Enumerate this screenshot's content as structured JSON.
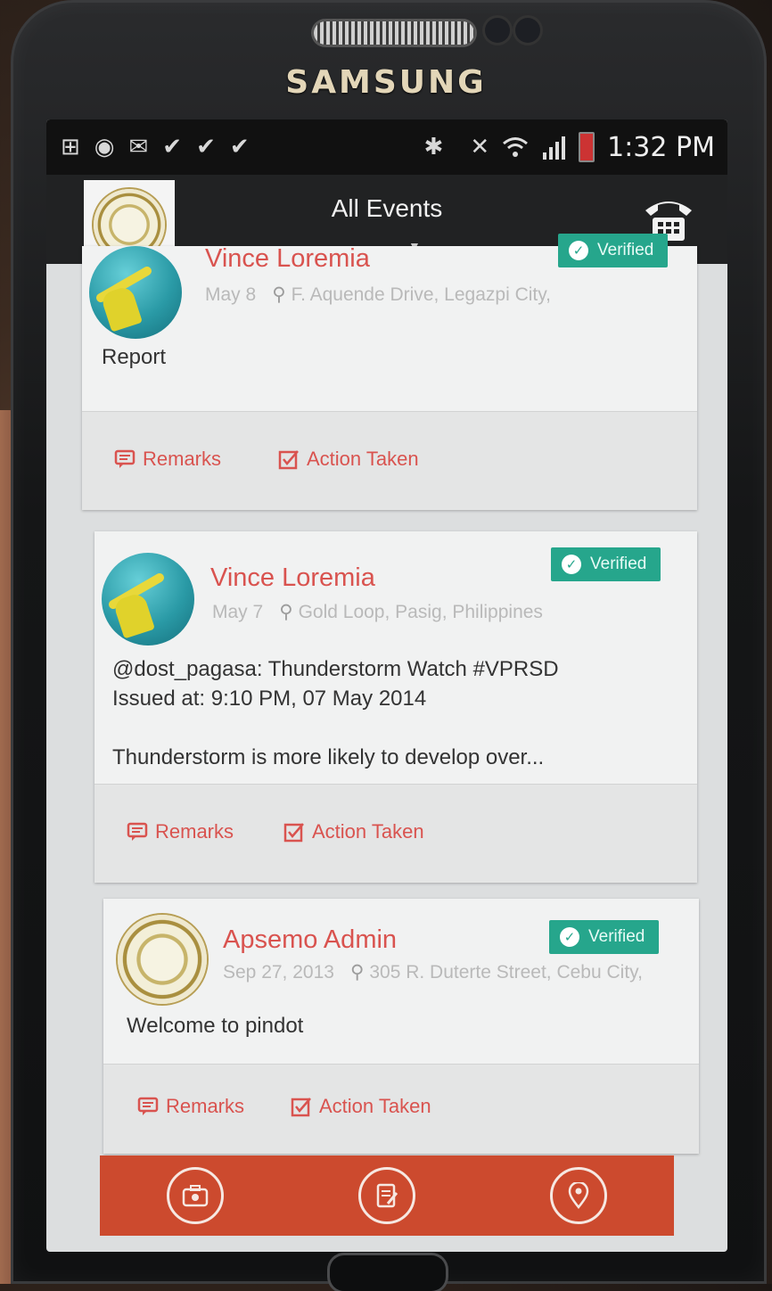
{
  "device": {
    "brand": "SAMSUNG"
  },
  "status_bar": {
    "time": "1:32 PM",
    "left_icons": [
      "plus-icon",
      "eye-icon",
      "mail-icon",
      "check-icon",
      "check-icon",
      "check-icon"
    ],
    "right_icons": [
      "bluetooth-icon",
      "mute-icon",
      "wifi-icon",
      "signal-icon",
      "battery-icon"
    ]
  },
  "app_bar": {
    "title": "All Events",
    "logo_icon": "province-seal-icon",
    "call_icon": "phone-icon"
  },
  "posts": [
    {
      "author": "Vince Loremia",
      "date": "May 8",
      "location": "F. Aquende Drive, Legazpi City,",
      "body": "Report",
      "verified_label": "Verified",
      "remarks_label": "Remarks",
      "action_label": "Action Taken"
    },
    {
      "author": "Vince Loremia",
      "date": "May 7",
      "location": "Gold Loop, Pasig, Philippines",
      "body": "@dost_pagasa: Thunderstorm Watch #VPRSD\nIssued at: 9:10 PM, 07 May 2014\n\nThunderstorm is more likely to develop over...",
      "verified_label": "Verified",
      "remarks_label": "Remarks",
      "action_label": "Action Taken"
    },
    {
      "author": "Apsemo Admin",
      "date": "Sep 27, 2013",
      "location": "305 R. Duterte Street, Cebu City,",
      "body": "Welcome to pindot",
      "verified_label": "Verified",
      "remarks_label": "Remarks",
      "action_label": "Action Taken"
    }
  ],
  "bottom_nav": {
    "items": [
      "first-aid-kit-icon",
      "notes-icon",
      "location-pin-icon"
    ]
  },
  "colors": {
    "accent_red": "#d9534f",
    "verified_green": "#26a68c",
    "nav_orange": "#cc4a2e",
    "app_bar": "#212223"
  }
}
